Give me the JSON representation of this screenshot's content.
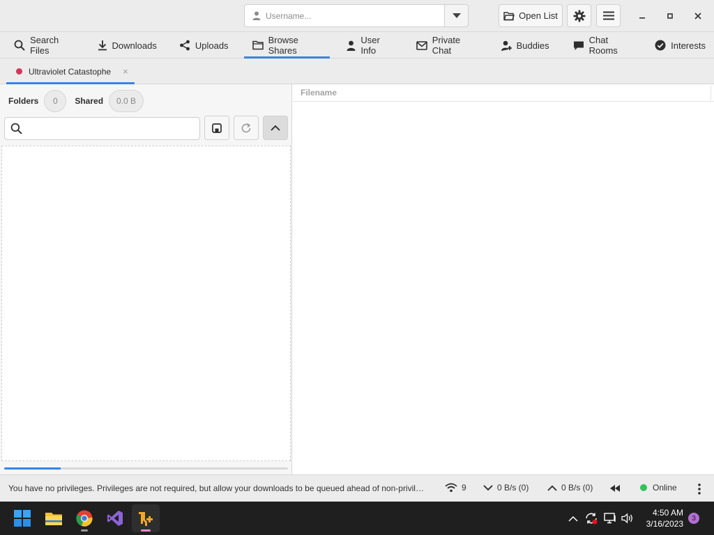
{
  "titlebar": {
    "username_placeholder": "Username...",
    "open_list_label": "Open List",
    "settings_icon": "gear-icon",
    "menu_icon": "hamburger-menu-icon",
    "window_controls": [
      "minimize",
      "maximize",
      "close"
    ]
  },
  "main_tabs": [
    {
      "label": "Search Files",
      "icon": "search-icon",
      "active": false
    },
    {
      "label": "Downloads",
      "icon": "download-icon",
      "active": false
    },
    {
      "label": "Uploads",
      "icon": "share-icon",
      "active": false
    },
    {
      "label": "Browse Shares",
      "icon": "folder-icon",
      "active": true
    },
    {
      "label": "User Info",
      "icon": "person-icon",
      "active": false
    },
    {
      "label": "Private Chat",
      "icon": "envelope-icon",
      "active": false
    },
    {
      "label": "Buddies",
      "icon": "person-add-icon",
      "active": false
    },
    {
      "label": "Chat Rooms",
      "icon": "chat-bubble-icon",
      "active": false
    },
    {
      "label": "Interests",
      "icon": "checkmark-circle-icon",
      "active": false
    }
  ],
  "user_tab": {
    "label": "Ultraviolet Catastophe",
    "status_color": "#d33658",
    "close_glyph": "×"
  },
  "browse": {
    "folders_label": "Folders",
    "folders_count": "0",
    "shared_label": "Shared",
    "shared_size": "0.0 B",
    "search_placeholder": "",
    "file_column_header": "Filename",
    "progress_fraction": 0.2
  },
  "statusbar": {
    "message": "You have no privileges. Privileges are not required, but allow your downloads to be queued ahead of non-privileged downloads.",
    "connections": "9",
    "download_speed": "0 B/s (0)",
    "upload_speed": "0 B/s (0)",
    "status": "Online",
    "status_color": "#33c15a"
  },
  "taskbar": {
    "apps": [
      "windows-start",
      "file-explorer",
      "chrome",
      "visual-studio",
      "nicotine-plus"
    ],
    "time": "4:50 AM",
    "date": "3/16/2023",
    "notification_count": "3"
  },
  "colors": {
    "accent": "#3584e4",
    "window_bg": "#ececec"
  }
}
